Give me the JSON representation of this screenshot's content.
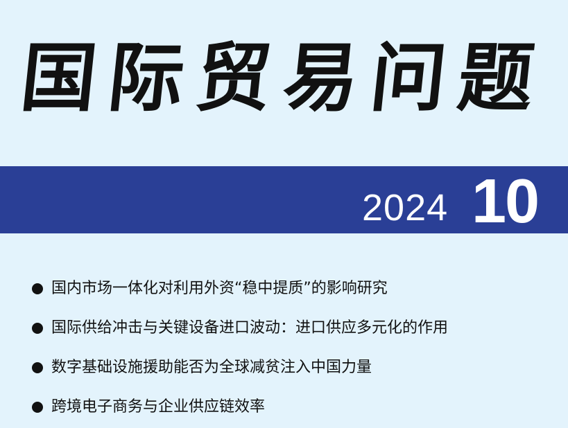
{
  "masthead": {
    "title": "国际贸易问题"
  },
  "issue": {
    "year": "2024",
    "number": "10"
  },
  "toc": {
    "items": [
      {
        "text": "国内市场一体化对利用外资“稳中提质”的影响研究"
      },
      {
        "text": "国际供给冲击与关键设备进口波动：进口供应多元化的作用"
      },
      {
        "text": "数字基础设施援助能否为全球减贫注入中国力量"
      },
      {
        "text": "跨境电子商务与企业供应链效率"
      }
    ]
  }
}
